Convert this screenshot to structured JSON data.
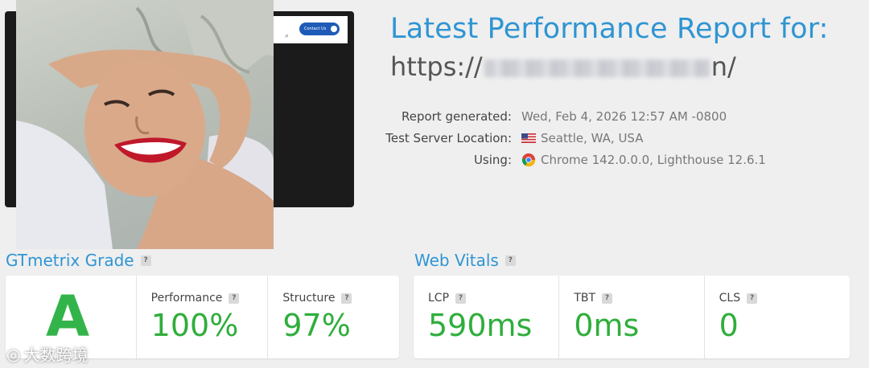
{
  "thumbnail": {
    "contact_label": "Contact Us"
  },
  "report": {
    "title": "Latest Performance Report for:",
    "url_prefix": "https://",
    "url_suffix": "n/"
  },
  "meta": {
    "generated_label": "Report generated:",
    "generated_value": "Wed, Feb 4, 2026 12:57 AM -0800",
    "location_label": "Test Server Location:",
    "location_value": "Seattle, WA, USA",
    "using_label": "Using:",
    "using_value": "Chrome 142.0.0.0, Lighthouse 12.6.1"
  },
  "grade": {
    "section_title": "GTmetrix Grade",
    "letter": "A",
    "performance_label": "Performance",
    "performance_value": "100%",
    "structure_label": "Structure",
    "structure_value": "97%"
  },
  "vitals": {
    "section_title": "Web Vitals",
    "lcp_label": "LCP",
    "lcp_value": "590ms",
    "tbt_label": "TBT",
    "tbt_value": "0ms",
    "cls_label": "CLS",
    "cls_value": "0"
  },
  "help_glyph": "?",
  "watermark": "大数跨境",
  "colors": {
    "accent_blue": "#2f95d3",
    "grade_green": "#33b44a",
    "value_green": "#2fae3c"
  }
}
